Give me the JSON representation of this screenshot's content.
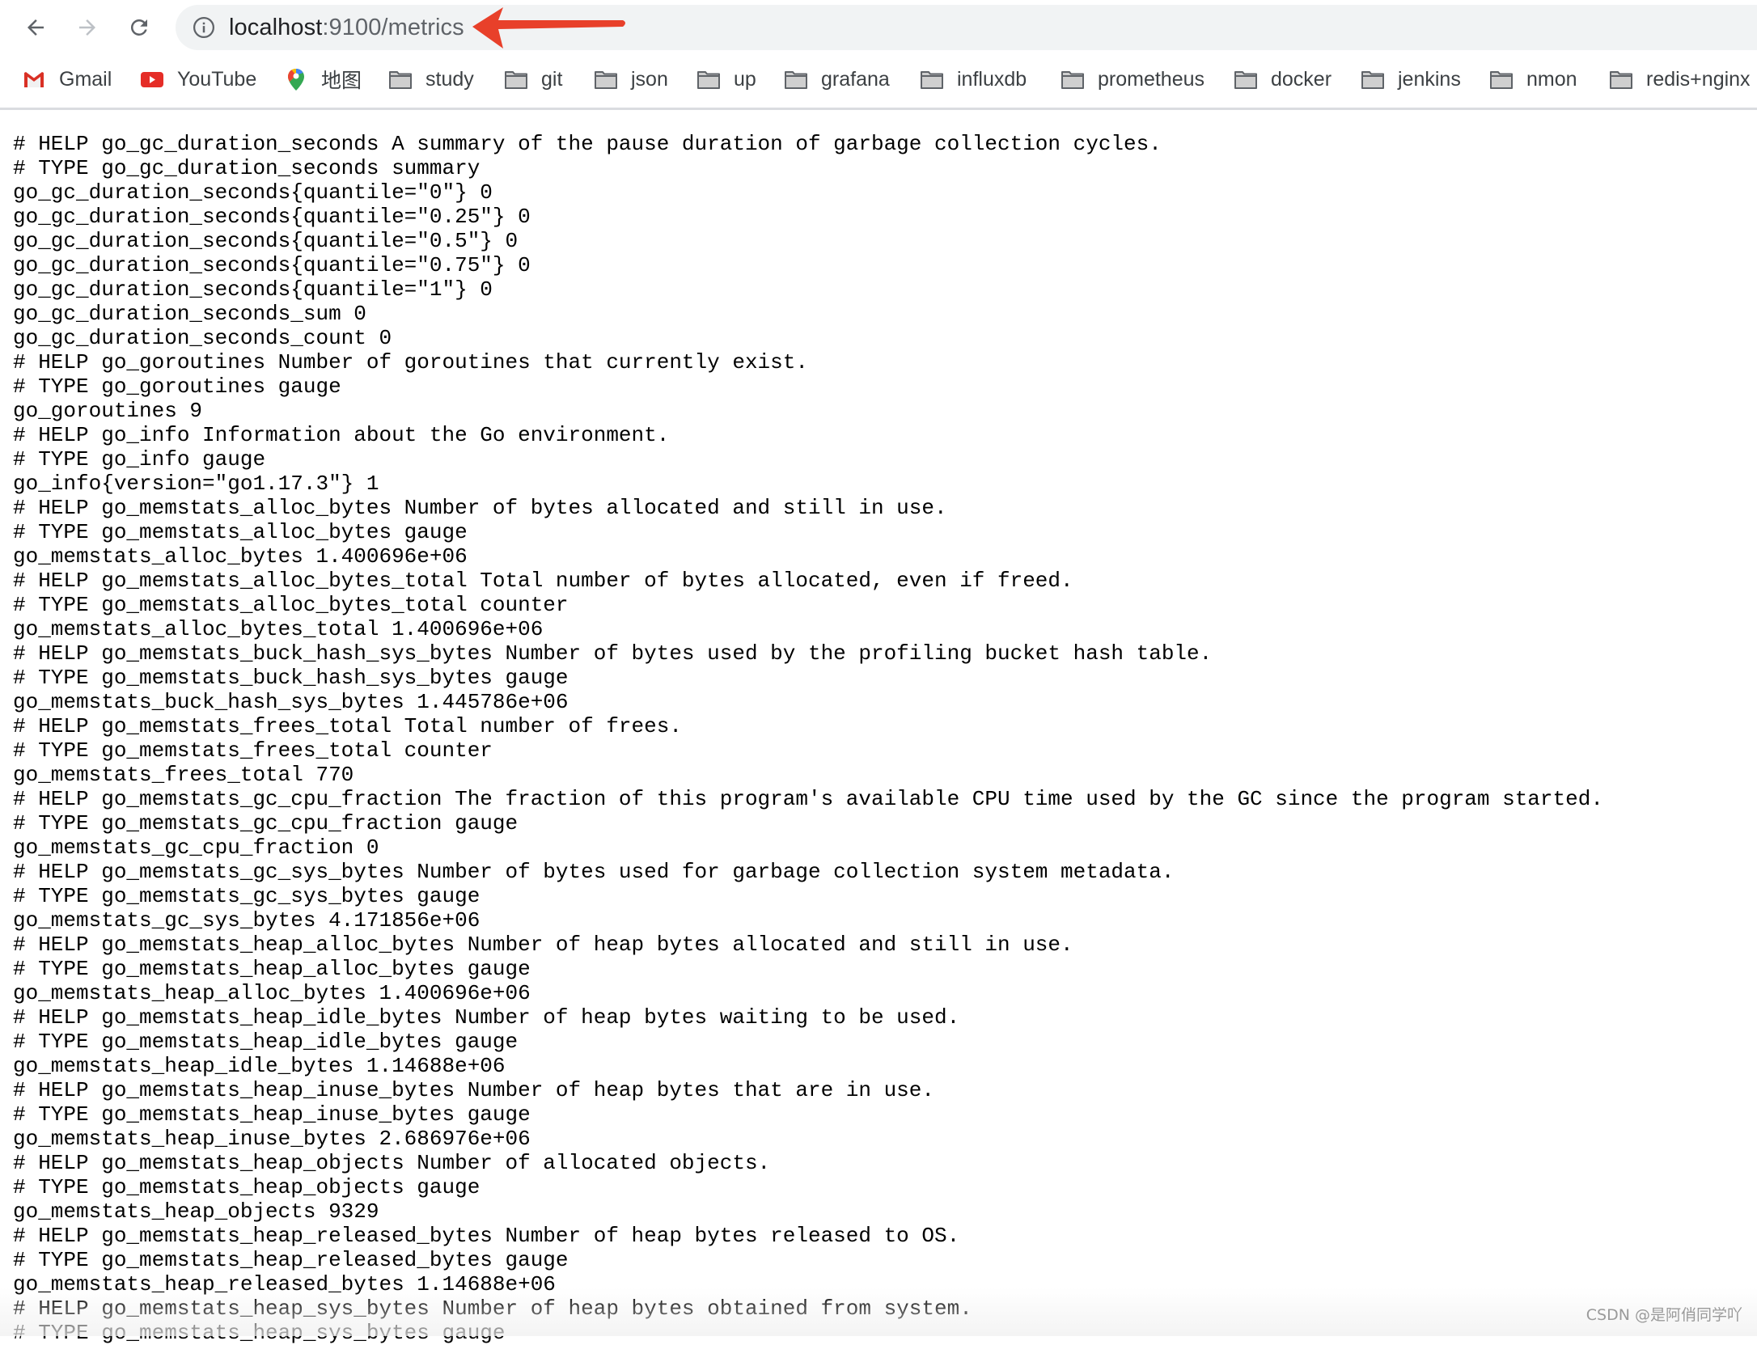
{
  "browser": {
    "url_host": "localhost",
    "url_rest": ":9100/metrics",
    "nav": {
      "back": "back-icon",
      "forward": "forward-icon",
      "reload": "reload-icon",
      "site_info": "info-icon"
    },
    "bookmarks": [
      {
        "label": "Gmail",
        "icon": "gmail-icon"
      },
      {
        "label": "YouTube",
        "icon": "youtube-icon"
      },
      {
        "label": "地图",
        "icon": "maps-icon"
      },
      {
        "label": "study",
        "icon": "folder-icon"
      },
      {
        "label": "git",
        "icon": "folder-icon"
      },
      {
        "label": "json",
        "icon": "folder-icon"
      },
      {
        "label": "up",
        "icon": "folder-icon"
      },
      {
        "label": "grafana",
        "icon": "folder-icon"
      },
      {
        "label": "influxdb",
        "icon": "folder-icon"
      },
      {
        "label": "prometheus",
        "icon": "folder-icon"
      },
      {
        "label": "docker",
        "icon": "folder-icon"
      },
      {
        "label": "jenkins",
        "icon": "folder-icon"
      },
      {
        "label": "nmon",
        "icon": "folder-icon"
      },
      {
        "label": "redis+nginx",
        "icon": "folder-icon"
      }
    ],
    "annotation_color": "#e8402a"
  },
  "metrics_lines": [
    "# HELP go_gc_duration_seconds A summary of the pause duration of garbage collection cycles.",
    "# TYPE go_gc_duration_seconds summary",
    "go_gc_duration_seconds{quantile=\"0\"} 0",
    "go_gc_duration_seconds{quantile=\"0.25\"} 0",
    "go_gc_duration_seconds{quantile=\"0.5\"} 0",
    "go_gc_duration_seconds{quantile=\"0.75\"} 0",
    "go_gc_duration_seconds{quantile=\"1\"} 0",
    "go_gc_duration_seconds_sum 0",
    "go_gc_duration_seconds_count 0",
    "# HELP go_goroutines Number of goroutines that currently exist.",
    "# TYPE go_goroutines gauge",
    "go_goroutines 9",
    "# HELP go_info Information about the Go environment.",
    "# TYPE go_info gauge",
    "go_info{version=\"go1.17.3\"} 1",
    "# HELP go_memstats_alloc_bytes Number of bytes allocated and still in use.",
    "# TYPE go_memstats_alloc_bytes gauge",
    "go_memstats_alloc_bytes 1.400696e+06",
    "# HELP go_memstats_alloc_bytes_total Total number of bytes allocated, even if freed.",
    "# TYPE go_memstats_alloc_bytes_total counter",
    "go_memstats_alloc_bytes_total 1.400696e+06",
    "# HELP go_memstats_buck_hash_sys_bytes Number of bytes used by the profiling bucket hash table.",
    "# TYPE go_memstats_buck_hash_sys_bytes gauge",
    "go_memstats_buck_hash_sys_bytes 1.445786e+06",
    "# HELP go_memstats_frees_total Total number of frees.",
    "# TYPE go_memstats_frees_total counter",
    "go_memstats_frees_total 770",
    "# HELP go_memstats_gc_cpu_fraction The fraction of this program's available CPU time used by the GC since the program started.",
    "# TYPE go_memstats_gc_cpu_fraction gauge",
    "go_memstats_gc_cpu_fraction 0",
    "# HELP go_memstats_gc_sys_bytes Number of bytes used for garbage collection system metadata.",
    "# TYPE go_memstats_gc_sys_bytes gauge",
    "go_memstats_gc_sys_bytes 4.171856e+06",
    "# HELP go_memstats_heap_alloc_bytes Number of heap bytes allocated and still in use.",
    "# TYPE go_memstats_heap_alloc_bytes gauge",
    "go_memstats_heap_alloc_bytes 1.400696e+06",
    "# HELP go_memstats_heap_idle_bytes Number of heap bytes waiting to be used.",
    "# TYPE go_memstats_heap_idle_bytes gauge",
    "go_memstats_heap_idle_bytes 1.14688e+06",
    "# HELP go_memstats_heap_inuse_bytes Number of heap bytes that are in use.",
    "# TYPE go_memstats_heap_inuse_bytes gauge",
    "go_memstats_heap_inuse_bytes 2.686976e+06",
    "# HELP go_memstats_heap_objects Number of allocated objects.",
    "# TYPE go_memstats_heap_objects gauge",
    "go_memstats_heap_objects 9329",
    "# HELP go_memstats_heap_released_bytes Number of heap bytes released to OS.",
    "# TYPE go_memstats_heap_released_bytes gauge",
    "go_memstats_heap_released_bytes 1.14688e+06",
    "# HELP go_memstats_heap_sys_bytes Number of heap bytes obtained from system.",
    "# TYPE go_memstats_heap_sys_bytes gauge"
  ],
  "watermark": "CSDN @是阿俏同学吖"
}
